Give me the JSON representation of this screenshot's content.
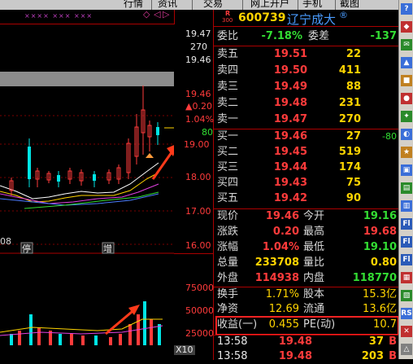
{
  "menu": {
    "items": [
      "行情",
      "资讯",
      "交易",
      "网上开户",
      "手机",
      "截图"
    ]
  },
  "chart": {
    "top_marks": "×××× ××× ×××",
    "price_axis": [
      "19.47",
      "270",
      "19.46",
      "19.46",
      "▲0.20",
      "1.04%",
      "80",
      "19.00",
      "18.00",
      "17.00",
      "16.00"
    ],
    "date_label": "08",
    "tag_stop": "停",
    "tag_increase": "增",
    "volume_axis": [
      "75000",
      "50000",
      "25000"
    ],
    "volume_unit": "X10"
  },
  "stock": {
    "badge_top": "R",
    "badge_bottom": "300",
    "code": "600739",
    "name": "辽宁成大",
    "symbol": "®"
  },
  "ratio": {
    "label_a": "委比",
    "value_a": "-7.18%",
    "label_b": "委差",
    "value_b": "-137"
  },
  "sell_orders": [
    {
      "label": "卖五",
      "price": "19.51",
      "vol": "22"
    },
    {
      "label": "卖四",
      "price": "19.50",
      "vol": "411"
    },
    {
      "label": "卖三",
      "price": "19.49",
      "vol": "88"
    },
    {
      "label": "卖二",
      "price": "19.48",
      "vol": "231"
    },
    {
      "label": "卖一",
      "price": "19.47",
      "vol": "270"
    }
  ],
  "buy_orders": [
    {
      "label": "买一",
      "price": "19.46",
      "vol": "27",
      "extra": "-80"
    },
    {
      "label": "买二",
      "price": "19.45",
      "vol": "519",
      "extra": ""
    },
    {
      "label": "买三",
      "price": "19.44",
      "vol": "174",
      "extra": ""
    },
    {
      "label": "买四",
      "price": "19.43",
      "vol": "75",
      "extra": ""
    },
    {
      "label": "买五",
      "price": "19.42",
      "vol": "90",
      "extra": ""
    }
  ],
  "stats": [
    {
      "l1": "现价",
      "v1": "19.46",
      "l2": "今开",
      "v2": "19.16"
    },
    {
      "l1": "涨跌",
      "v1": "0.20",
      "l2": "最高",
      "v2": "19.68"
    },
    {
      "l1": "涨幅",
      "v1": "1.04%",
      "l2": "最低",
      "v2": "19.10"
    },
    {
      "l1": "总量",
      "v1": "233708",
      "l2": "量比",
      "v2": "0.80"
    },
    {
      "l1": "外盘",
      "v1": "114938",
      "l2": "内盘",
      "v2": "118770"
    },
    {
      "l1": "换手",
      "v1": "1.71%",
      "l2": "股本",
      "v2": "15.3亿"
    },
    {
      "l1": "净资",
      "v1": "12.69",
      "l2": "流通",
      "v2": "13.6亿"
    },
    {
      "l1": "收益(一)",
      "v1": "0.455",
      "l2": "PE(动)",
      "v2": "10.7"
    }
  ],
  "ticks": [
    {
      "time": "13:58",
      "price": "19.48",
      "vol": "37",
      "flag": "B"
    },
    {
      "time": "13:58",
      "price": "19.48",
      "vol": "203",
      "flag": "B"
    }
  ],
  "side_icons": [
    "?",
    "◆",
    "✉",
    "▲",
    "■",
    "●",
    "✦",
    "◐",
    "★",
    "▣",
    "▤",
    "▥",
    "Fl",
    "Fl",
    "Fl",
    "▦",
    "▧",
    "RS",
    "✕",
    "△"
  ],
  "colors": {
    "up": "#ff3b3b",
    "down": "#33dd33",
    "highlight_box": "#ff2222",
    "arrow": "#ff3a1a"
  }
}
